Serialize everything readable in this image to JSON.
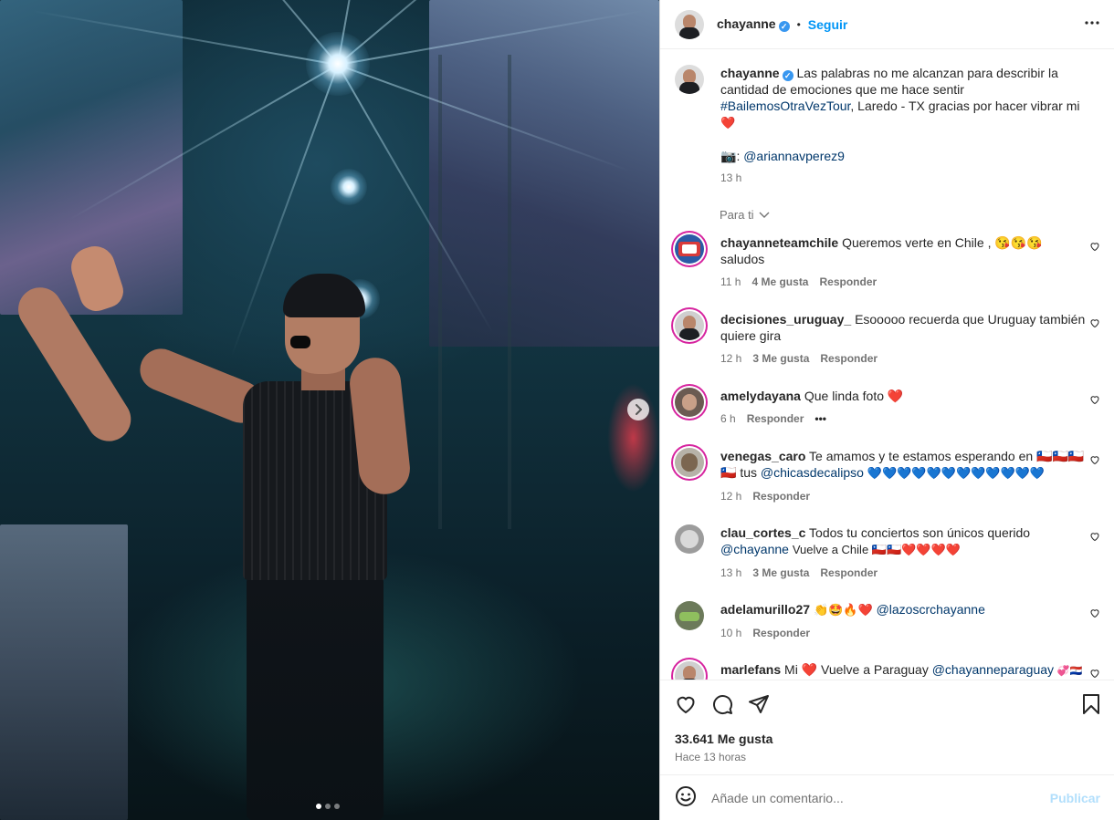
{
  "post": {
    "author": "chayanne",
    "verified_mark": "✓",
    "bullet": "•",
    "follow_label": "Seguir",
    "caption_text": "Las palabras no me alcanzan para describir la cantidad de emociones que me hace sentir",
    "caption_hashtag": "#BailemosOtraVezTour",
    "caption_rest": ", Laredo - TX gracias por hacer vibrar mi",
    "caption_heart": "❤️",
    "photo_credit_icon": "📷",
    "photo_credit_sep": ":",
    "photo_credit": "@ariannavperez9",
    "time": "13 h",
    "para_ti": "Para ti",
    "likes": "33.641 Me gusta",
    "posted": "Hace 13 horas"
  },
  "comments": [
    {
      "user": "chayanneteamchile",
      "text": "Queremos verte en Chile , 😘😘😘 saludos",
      "time": "11 h",
      "likes": "4 Me gusta",
      "reply": "Responder"
    },
    {
      "user": "decisiones_uruguay_",
      "text": "Esooooo recuerda que Uruguay también quiere gira",
      "time": "12 h",
      "likes": "3 Me gusta",
      "reply": "Responder"
    },
    {
      "user": "amelydayana",
      "text": "Que linda foto ❤️",
      "time": "6 h",
      "reply": "Responder",
      "more": "•••"
    },
    {
      "user": "venegas_caro",
      "text": "Te amamos y te estamos esperando en 🇨🇱🇨🇱🇨🇱🇨🇱 tus",
      "mention": "@chicasdecalipso",
      "tail": "💙💙💙💙💙💙💙💙💙💙💙💙",
      "time": "12 h",
      "reply": "Responder"
    },
    {
      "user": "clau_cortes_c",
      "text": "Todos tu conciertos son únicos querido",
      "mention": "@chayanne",
      "tail": "Vuelve a Chile 🇨🇱🇨🇱❤️❤️❤️❤️",
      "time": "13 h",
      "likes": "3 Me gusta",
      "reply": "Responder"
    },
    {
      "user": "adelamurillo27",
      "text": "👏🤩🔥❤️",
      "mention": "@lazoscrchayanne",
      "time": "10 h",
      "reply": "Responder"
    },
    {
      "user": "marlefans",
      "text": "Mi ❤️ Vuelve a Paraguay",
      "mention": "@chayanneparaguay",
      "tail": "💞🇵🇾"
    }
  ],
  "add_comment": {
    "placeholder": "Añade un comentario...",
    "publish": "Publicar"
  },
  "carousel": {
    "current": 1,
    "total": 3
  },
  "icons": [
    "more-options-icon",
    "heart-icon",
    "comment-icon",
    "share-icon",
    "bookmark-icon",
    "emoji-icon",
    "chevron-right-icon",
    "chevron-down-icon"
  ],
  "colors": {
    "accent": "#0095f6",
    "verified": "#3897f0",
    "link": "#00376b",
    "publish_disabled": "#b2dffc"
  }
}
